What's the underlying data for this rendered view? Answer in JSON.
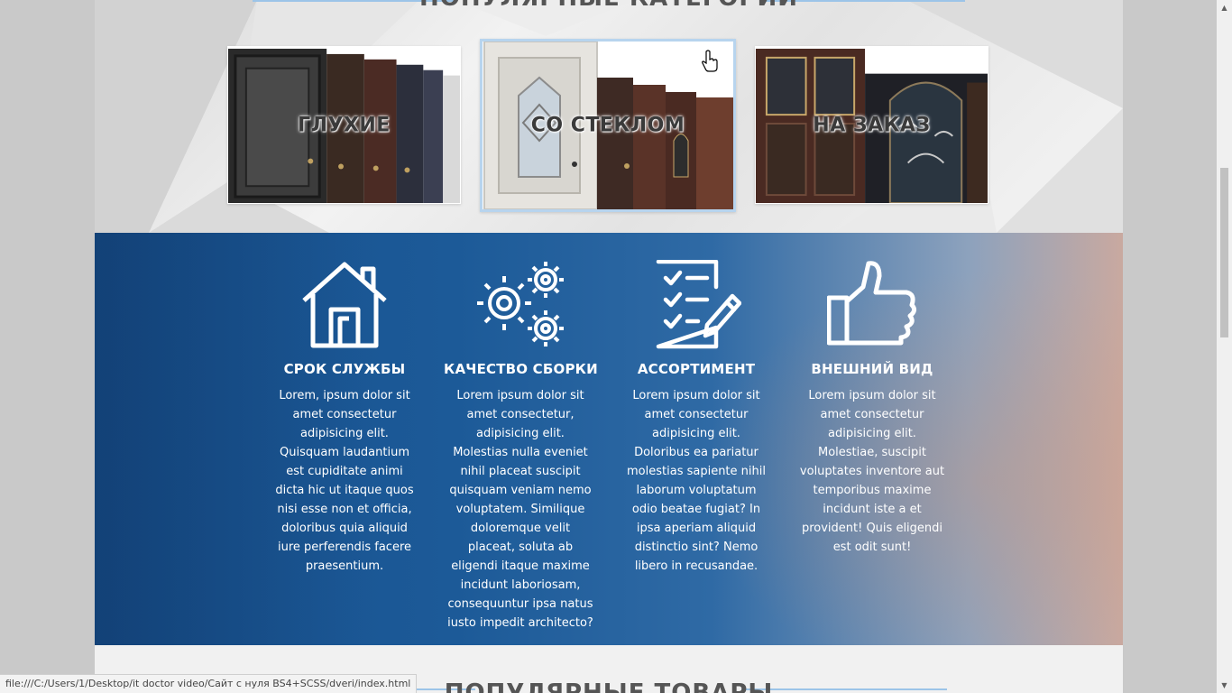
{
  "top": {
    "heading": "ПОПУЛЯРНЫЕ КАТЕГОРИИ",
    "categories": [
      {
        "label": "ГЛУХИЕ"
      },
      {
        "label": "СО СТЕКЛОМ"
      },
      {
        "label": "НА ЗАКАЗ"
      }
    ]
  },
  "features": [
    {
      "icon": "house-icon",
      "title": "СРОК СЛУЖБЫ",
      "text": "Lorem, ipsum dolor sit amet consectetur adipisicing elit. Quisquam laudantium est cupiditate animi dicta hic ut itaque quos nisi esse non et officia, doloribus quia aliquid iure perferendis facere praesentium."
    },
    {
      "icon": "gears-icon",
      "title": "КАЧЕСТВО СБОРКИ",
      "text": "Lorem ipsum dolor sit amet consectetur, adipisicing elit. Molestias nulla eveniet nihil placeat suscipit quisquam veniam nemo voluptatem. Similique doloremque velit placeat, soluta ab eligendi itaque maxime incidunt laboriosam, consequuntur ipsa natus iusto impedit architecto?"
    },
    {
      "icon": "checklist-icon",
      "title": "АССОРТИМЕНТ",
      "text": "Lorem ipsum dolor sit amet consectetur adipisicing elit. Doloribus ea pariatur molestias sapiente nihil laborum voluptatum odio beatae fugiat? In ipsa aperiam aliquid distinctio sint? Nemo libero in recusandae."
    },
    {
      "icon": "thumbs-up-icon",
      "title": "ВНЕШНИЙ ВИД",
      "text": "Lorem ipsum dolor sit amet consectetur adipisicing elit. Molestiae, suscipit voluptates inventore aut temporibus maxime incidunt iste a et provident! Quis eligendi est odit sunt!"
    }
  ],
  "bottom": {
    "heading": "ПОПУЛЯРНЫЕ ТОВАРЫ"
  },
  "status_bar": {
    "url": "file:///C:/Users/1/Desktop/it doctor video/Сайт с нуля BS4+SCSS/dveri/index.html"
  },
  "colors": {
    "accent_line": "#9cc4e8",
    "features_bg": "#1c5a98"
  }
}
